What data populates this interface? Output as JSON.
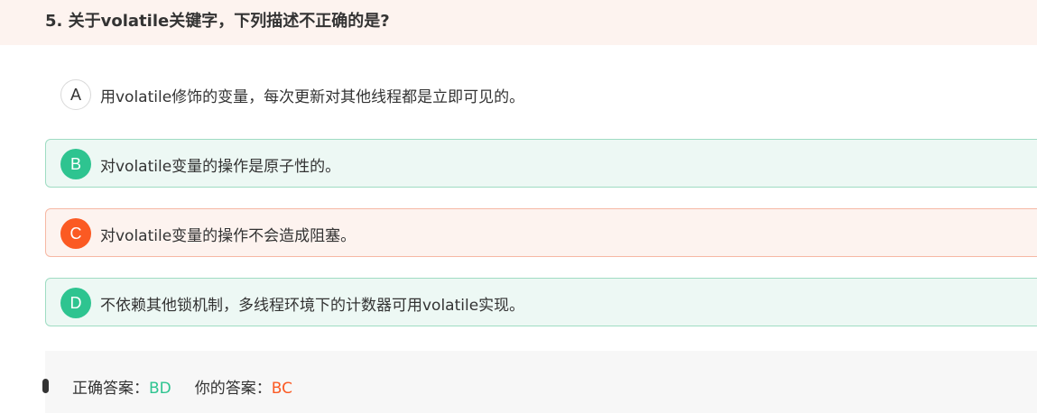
{
  "question": {
    "title": "5. 关于volatile关键字，下列描述不正确的是?"
  },
  "options": [
    {
      "letter": "A",
      "text": "用volatile修饰的变量，每次更新对其他线程都是立即可见的。",
      "state": "plain"
    },
    {
      "letter": "B",
      "text": "对volatile变量的操作是原子性的。",
      "state": "correct"
    },
    {
      "letter": "C",
      "text": "对volatile变量的操作不会造成阻塞。",
      "state": "wrong"
    },
    {
      "letter": "D",
      "text": "不依赖其他锁机制，多线程环境下的计数器可用volatile实现。",
      "state": "correct"
    }
  ],
  "answer": {
    "correct_label": "正确答案：",
    "correct_value": "BD",
    "yours_label": "你的答案：",
    "yours_value": "BC"
  },
  "colors": {
    "correct": "#2ec490",
    "wrong": "#fb5a23",
    "header_bg": "#fdf3ef"
  }
}
